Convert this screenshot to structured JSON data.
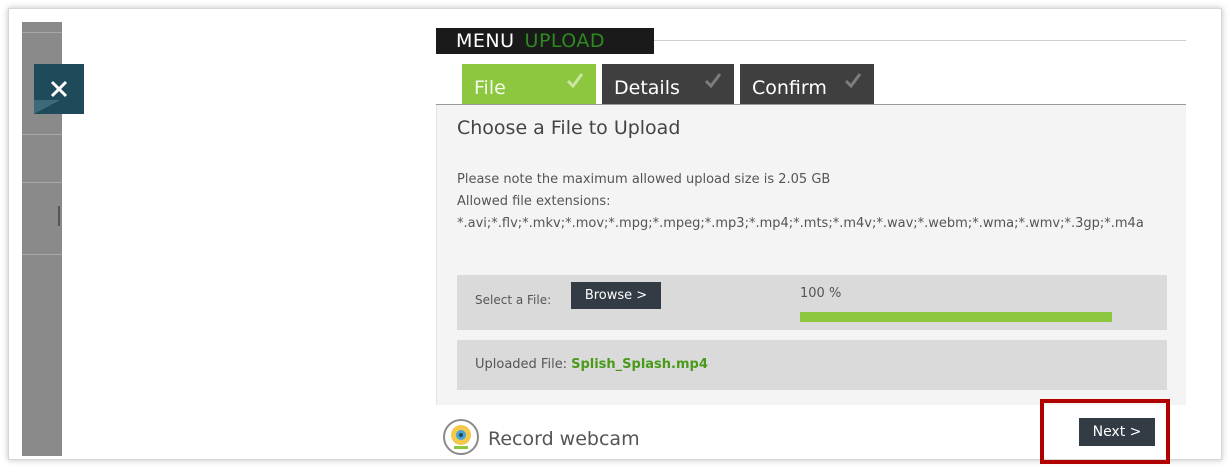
{
  "header": {
    "menu_label": "MENU",
    "upload_label": "UPLOAD"
  },
  "tabs": [
    {
      "label": "File",
      "state": "active",
      "icon": "check-icon"
    },
    {
      "label": "Details",
      "state": "inactive",
      "icon": "check-icon"
    },
    {
      "label": "Confirm",
      "state": "inactive",
      "icon": "check-icon"
    }
  ],
  "panel": {
    "title": "Choose a File to Upload",
    "max_size_note": "Please note the maximum allowed upload size is 2.05 GB",
    "extensions_label": "Allowed file extensions:",
    "extensions": "*.avi;*.flv;*.mkv;*.mov;*.mpg;*.mpeg;*.mp3;*.mp4;*.mts;*.m4v;*.wav;*.webm;*.wma;*.wmv;*.3gp;*.m4a"
  },
  "file_select": {
    "label": "Select a File:",
    "browse_label": "Browse >",
    "progress_text": "100 %",
    "progress_fraction": 1.0
  },
  "uploaded": {
    "label": "Uploaded File:",
    "file_name": "Splish_Splash.mp4"
  },
  "footer": {
    "webcam_label": "Record webcam",
    "next_label": "Next >"
  },
  "colors": {
    "accent_green": "#8dc63f",
    "upload_green": "#2d8a1f",
    "dark_button": "#333c44",
    "close_button": "#1f4a5a",
    "highlight_red": "#b00000"
  }
}
